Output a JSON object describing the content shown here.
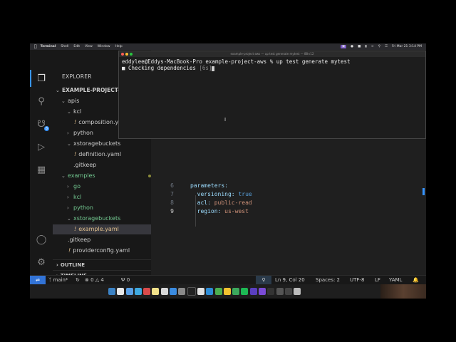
{
  "menubar": {
    "app": "Terminal",
    "items": [
      "Shell",
      "Edit",
      "View",
      "Window",
      "Help"
    ],
    "datetime": "Fri Mar 21 3:14 PM"
  },
  "activity": {
    "icons": [
      "files-icon",
      "search-icon",
      "source-control-icon",
      "run-debug-icon",
      "extensions-icon",
      "account-icon",
      "settings-gear-icon"
    ],
    "source_control_badge": "8"
  },
  "sidebar": {
    "title": "EXPLORER",
    "project": "EXAMPLE-PROJECT-AWS",
    "tree": [
      {
        "label": "apis"
      },
      {
        "label": "kcl"
      },
      {
        "label": "composition.yaml"
      },
      {
        "label": "python"
      },
      {
        "label": "xstoragebuckets"
      },
      {
        "label": "definition.yaml"
      },
      {
        "label": ".gitkeep"
      },
      {
        "label": "examples"
      },
      {
        "label": "go"
      },
      {
        "label": "kcl"
      },
      {
        "label": "python"
      },
      {
        "label": "xstoragebuckets"
      },
      {
        "label": "example.yaml",
        "badge": "1"
      },
      {
        "label": ".gitkeep"
      },
      {
        "label": "providerconfig.yaml"
      }
    ],
    "outline": "OUTLINE",
    "timeline": "TIMELINE"
  },
  "editor": {
    "lines": [
      {
        "n": "6",
        "key": "parameters:",
        "val": ""
      },
      {
        "n": "7",
        "key": "  versioning: ",
        "val": "true"
      },
      {
        "n": "8",
        "key": "  acl: ",
        "val": "public-read"
      },
      {
        "n": "9",
        "key": "  region: ",
        "val": "us-west"
      }
    ]
  },
  "terminal": {
    "title": "example-project-aws — up test generate mytest — 88×12",
    "prompt": "eddylee@Eddys-MacBook-Pro example-project-aws % up test generate mytest",
    "status": "Checking dependencies",
    "elapsed": "[6s]"
  },
  "statusbar": {
    "branch": "main*",
    "errors": "0",
    "warnings": "4",
    "ports": "0",
    "position": "Ln 9, Col 20",
    "spaces": "Spaces: 2",
    "encoding": "UTF-8",
    "eol": "LF",
    "language": "YAML"
  },
  "colors": {
    "accent": "#3794ff",
    "remote": "#3273d6",
    "git_added": "#73c991",
    "git_modified": "#e2c08d"
  }
}
